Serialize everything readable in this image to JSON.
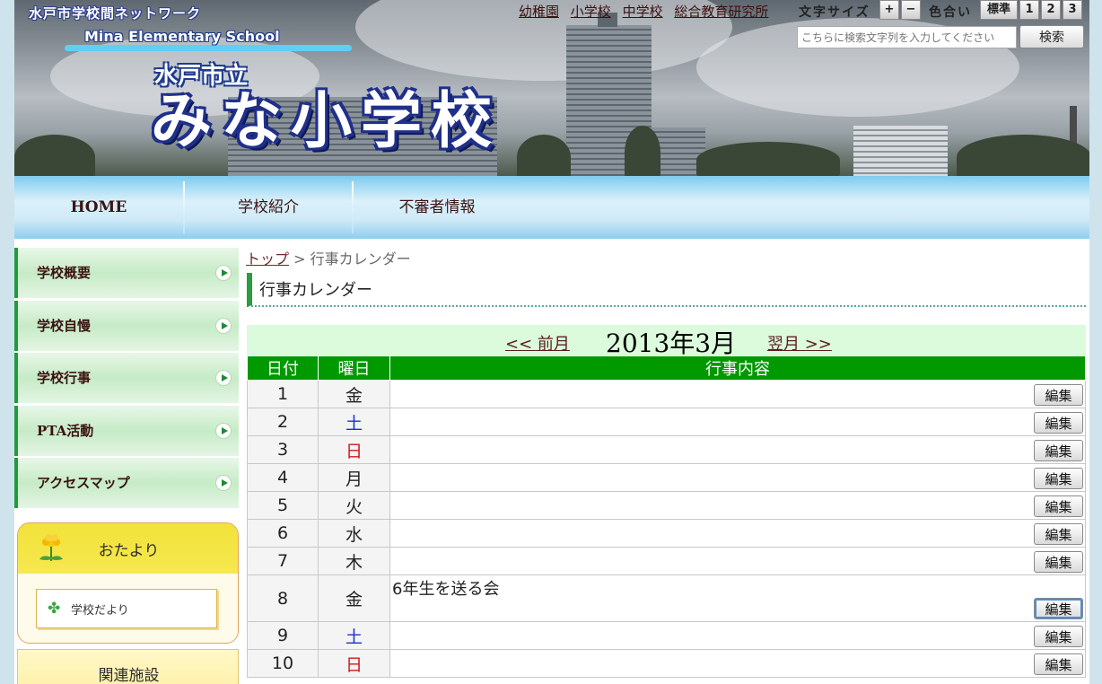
{
  "header": {
    "network_label": "水戸市学校間ネットワーク",
    "school_en": "Mina Elementary School",
    "city_label": "水戸市立",
    "school_name": "みな小学校"
  },
  "top_links": [
    "幼稚園",
    "小学校",
    "中学校",
    "総合教育研究所"
  ],
  "font_size": {
    "label": "文字サイズ",
    "plus": "+",
    "minus": "−"
  },
  "color_scheme": {
    "label": "色合い",
    "options": [
      "標準",
      "1",
      "2",
      "3"
    ]
  },
  "search": {
    "placeholder": "こちらに検索文字列を入力してください",
    "button_label": "検索"
  },
  "nav": {
    "items": [
      "HOME",
      "学校紹介",
      "不審者情報"
    ]
  },
  "sidebar": {
    "items": [
      "学校概要",
      "学校自慢",
      "学校行事",
      "PTA活動",
      "アクセスマップ"
    ],
    "otayori": {
      "title": "おたより",
      "link": "学校だより"
    },
    "related_title": "関連施設"
  },
  "breadcrumb": {
    "top": "トップ",
    "separator": ">",
    "current": "行事カレンダー"
  },
  "page_title": "行事カレンダー",
  "calendar": {
    "prev_label": "<< 前月",
    "month_label": "2013年3月",
    "next_label": "翌月 >>",
    "headers": [
      "日付",
      "曜日",
      "行事内容"
    ],
    "edit_label": "編集",
    "rows": [
      {
        "date": "1",
        "weekday": "金",
        "event": "",
        "day_type": "weekday"
      },
      {
        "date": "2",
        "weekday": "土",
        "event": "",
        "day_type": "saturday"
      },
      {
        "date": "3",
        "weekday": "日",
        "event": "",
        "day_type": "sunday"
      },
      {
        "date": "4",
        "weekday": "月",
        "event": "",
        "day_type": "weekday"
      },
      {
        "date": "5",
        "weekday": "火",
        "event": "",
        "day_type": "weekday"
      },
      {
        "date": "6",
        "weekday": "水",
        "event": "",
        "day_type": "weekday"
      },
      {
        "date": "7",
        "weekday": "木",
        "event": "",
        "day_type": "weekday"
      },
      {
        "date": "8",
        "weekday": "金",
        "event": "6年生を送る会",
        "day_type": "weekday"
      },
      {
        "date": "9",
        "weekday": "土",
        "event": "",
        "day_type": "saturday"
      },
      {
        "date": "10",
        "weekday": "日",
        "event": "",
        "day_type": "sunday"
      }
    ]
  },
  "colors": {
    "table_header": "#009900",
    "sidebar_accent": "#1f9b3a",
    "saturday": "#1a2fd0",
    "sunday": "#d01818"
  }
}
